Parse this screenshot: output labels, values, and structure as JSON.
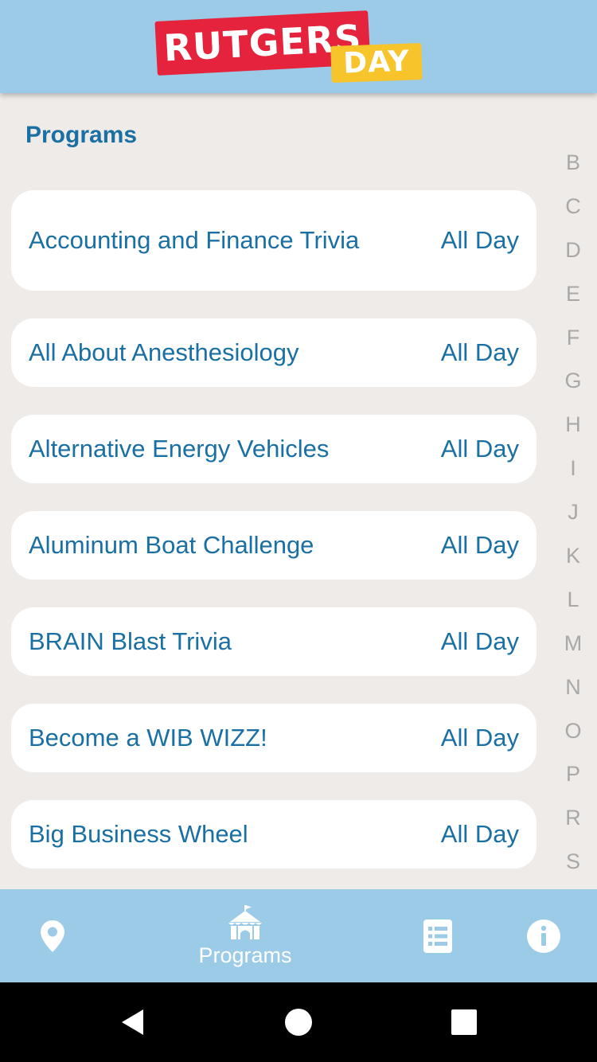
{
  "header": {
    "logo_line1": "RUTGERS",
    "logo_line2": "DAY"
  },
  "page": {
    "title": "Programs"
  },
  "programs": [
    {
      "name": "Accounting and Finance Trivia",
      "time": "All Day"
    },
    {
      "name": "All About Anesthesiology",
      "time": "All Day"
    },
    {
      "name": "Alternative Energy Vehicles",
      "time": "All Day"
    },
    {
      "name": "Aluminum Boat Challenge",
      "time": "All Day"
    },
    {
      "name": "BRAIN Blast Trivia",
      "time": "All Day"
    },
    {
      "name": "Become a WIB WIZZ!",
      "time": "All Day"
    },
    {
      "name": "Big Business Wheel",
      "time": "All Day"
    }
  ],
  "alpha_index": [
    "B",
    "C",
    "D",
    "E",
    "F",
    "G",
    "H",
    "I",
    "J",
    "K",
    "L",
    "M",
    "N",
    "O",
    "P",
    "R",
    "S"
  ],
  "bottom_nav": {
    "map_icon": "map-pin-icon",
    "programs_icon": "tent-icon",
    "programs_label": "Programs",
    "list_icon": "list-icon",
    "info_icon": "info-icon"
  },
  "system_nav": {
    "back_icon": "back-triangle-icon",
    "home_icon": "home-circle-icon",
    "recents_icon": "recents-square-icon"
  },
  "colors": {
    "header_bg": "#9ccbe8",
    "page_bg": "#efebe8",
    "accent_text": "#1a6fa3",
    "index_text": "#a8a8a8",
    "logo_red": "#e5233d",
    "logo_yellow": "#f7c52b"
  }
}
